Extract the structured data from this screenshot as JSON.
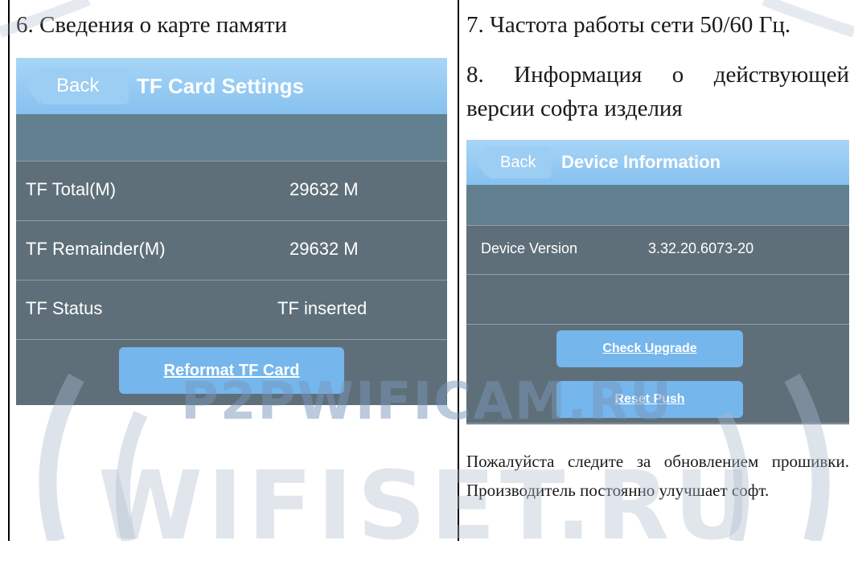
{
  "left": {
    "heading": "6. Сведения о карте памяти",
    "screen": {
      "back_label": "Back",
      "title": "TF Card Settings",
      "rows": [
        {
          "label": "TF Total(M)",
          "value": "29632 M"
        },
        {
          "label": "TF Remainder(M)",
          "value": "29632 M"
        },
        {
          "label": "TF Status",
          "value": "TF inserted"
        }
      ],
      "reformat_label": "Reformat TF Card"
    }
  },
  "right": {
    "item7": "7. Частота работы сети 50/60 Гц.",
    "item8": "8. Информация о действующей версии софта изделия",
    "screen": {
      "back_label": "Back",
      "title": "Device Information",
      "version_label": "Device Version",
      "version_value": "3.32.20.6073-20",
      "check_upgrade_label": "Check Upgrade",
      "reset_push_label": "Reset Push"
    },
    "note": "Пожалуйста следите за обновлением прошивки. Производитель постоянно улучшает софт."
  },
  "watermark": {
    "top": "P2PWIFICAM.RU",
    "bottom": "WIFISET.RU"
  }
}
